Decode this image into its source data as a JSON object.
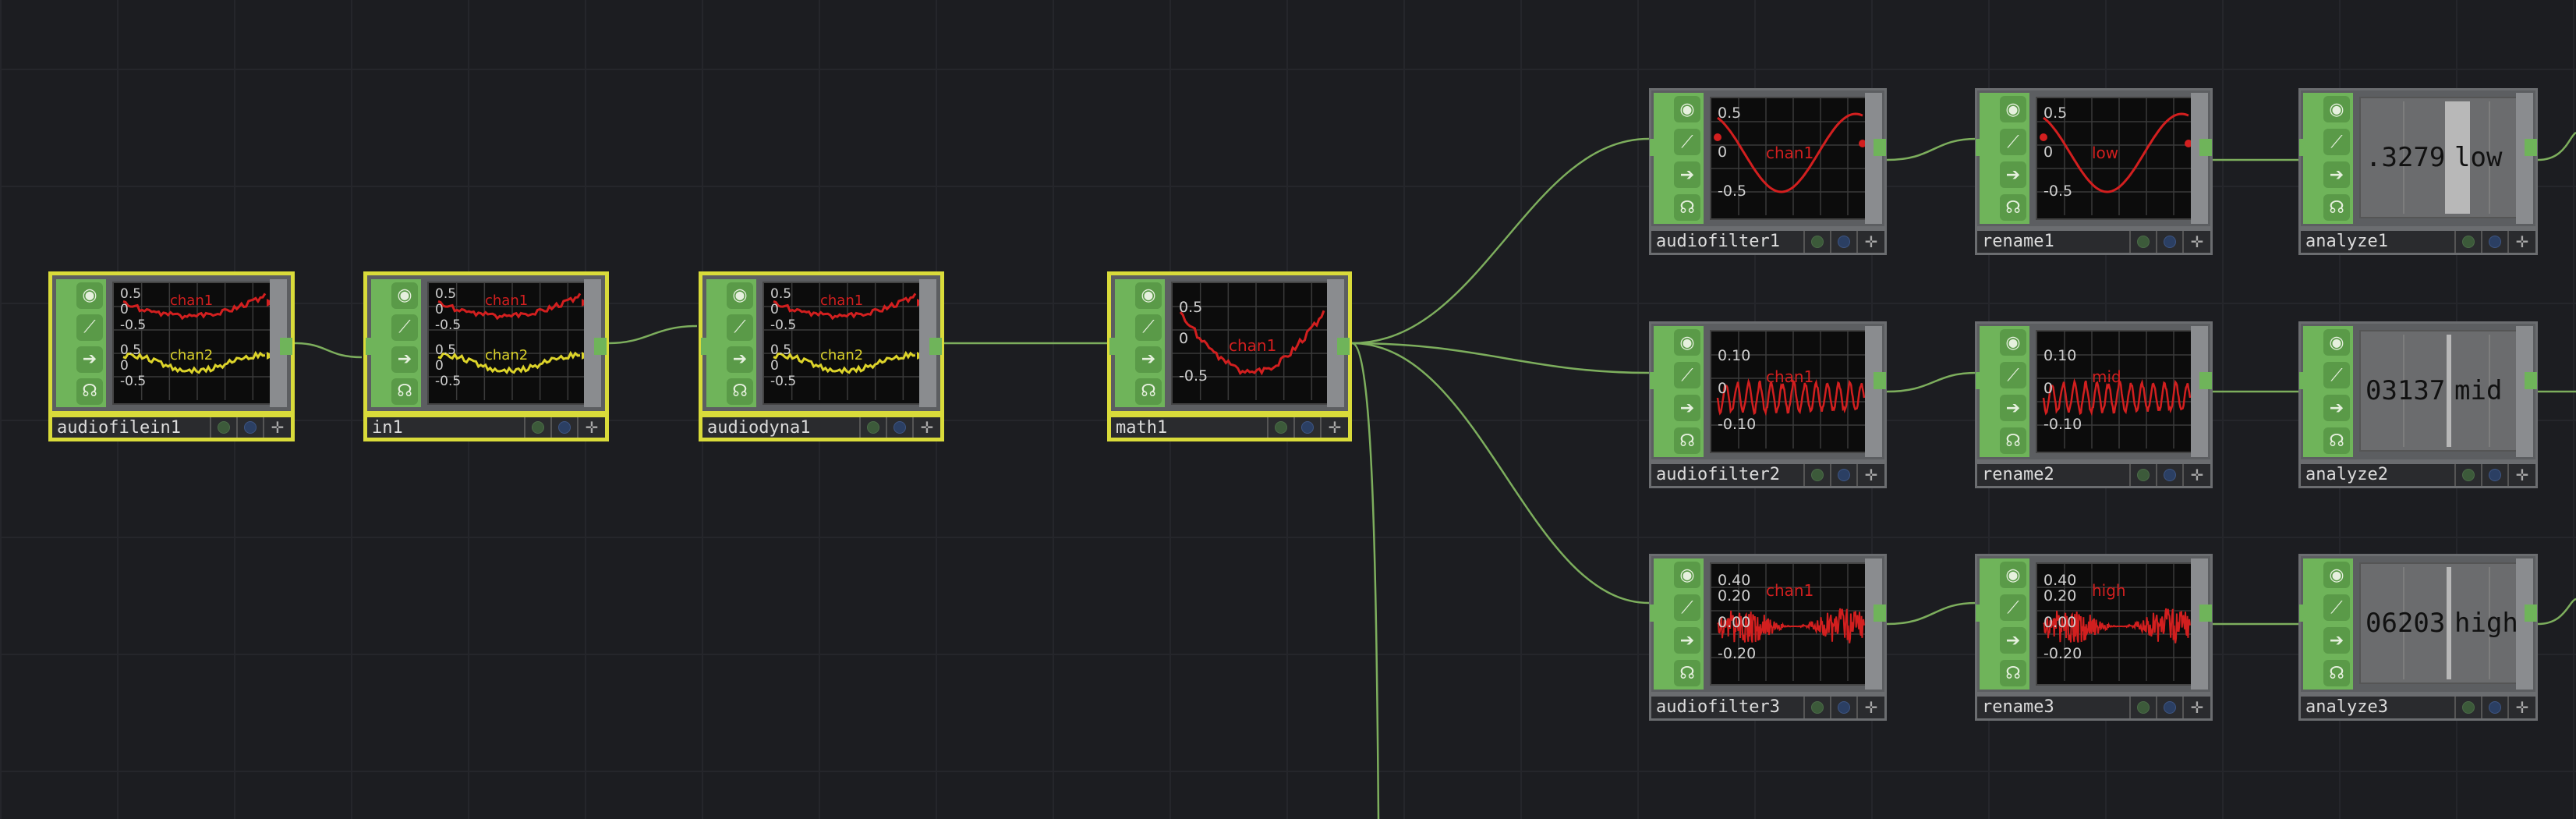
{
  "colors": {
    "background": "#1c1d21",
    "selected_border": "#d9db3a",
    "chop_green": "#6fb45a",
    "wire": "#7dae5d",
    "channel_red": "#d21f1f",
    "channel_yellow": "#dcd32a"
  },
  "icons": [
    "viewer-toggle-icon",
    "cook-icon",
    "export-icon",
    "lock-icon",
    "bypass-dot-icon",
    "display-dot-icon",
    "viewer-expand-icon"
  ],
  "nodes": {
    "audiofilein1": {
      "name": "audiofilein1",
      "ticks": [
        "0.5",
        "0",
        "-0.5",
        "0.5",
        "0",
        "-0.5"
      ],
      "chans": [
        "chan1",
        "chan2"
      ]
    },
    "in1": {
      "name": "in1",
      "ticks": [
        "0.5",
        "0",
        "-0.5",
        "0.5",
        "0",
        "-0.5"
      ],
      "chans": [
        "chan1",
        "chan2"
      ]
    },
    "audiodyna1": {
      "name": "audiodyna1",
      "ticks": [
        "0.5",
        "0",
        "-0.5",
        "0.5",
        "0",
        "-0.5"
      ],
      "chans": [
        "chan1",
        "chan2"
      ]
    },
    "math1": {
      "name": "math1",
      "ticks": [
        "0.5",
        "0",
        "-0.5"
      ],
      "chans": [
        "chan1"
      ]
    },
    "audiofilter1": {
      "name": "audiofilter1",
      "ticks": [
        "0.5",
        "0",
        "-0.5"
      ],
      "chans": [
        "chan1"
      ]
    },
    "rename1": {
      "name": "rename1",
      "ticks": [
        "0.5",
        "0",
        "-0.5"
      ],
      "chans": [
        "low"
      ]
    },
    "analyze1": {
      "name": "analyze1",
      "value": ".3279",
      "chan": "low"
    },
    "audiofilter2": {
      "name": "audiofilter2",
      "ticks": [
        "0.10",
        "0",
        "-0.10"
      ],
      "chans": [
        "chan1"
      ]
    },
    "rename2": {
      "name": "rename2",
      "ticks": [
        "0.10",
        "0",
        "-0.10"
      ],
      "chans": [
        "mid"
      ]
    },
    "analyze2": {
      "name": "analyze2",
      "value": "03137",
      "chan": "mid"
    },
    "audiofilter3": {
      "name": "audiofilter3",
      "ticks": [
        "0.40",
        "0.20",
        "0.00",
        "-0.20"
      ],
      "chans": [
        "chan1"
      ]
    },
    "rename3": {
      "name": "rename3",
      "ticks": [
        "0.40",
        "0.20",
        "0.00",
        "-0.20"
      ],
      "chans": [
        "high"
      ]
    },
    "analyze3": {
      "name": "analyze3",
      "value": "06203",
      "chan": "high"
    }
  }
}
